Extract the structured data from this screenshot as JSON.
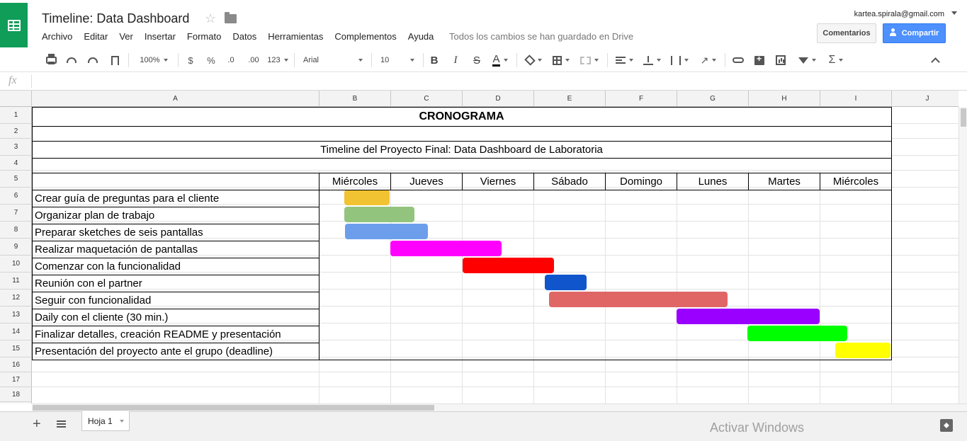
{
  "app": {
    "title": "Timeline: Data Dashboard",
    "account": "kartea.spirala@gmail.com",
    "save_status": "Todos los cambios se han guardado en Drive"
  },
  "menu": [
    "Archivo",
    "Editar",
    "Ver",
    "Insertar",
    "Formato",
    "Datos",
    "Herramientas",
    "Complementos",
    "Ayuda"
  ],
  "buttons": {
    "comments": "Comentarios",
    "share": "Compartir"
  },
  "toolbar": {
    "zoom": "100%",
    "currency": "$",
    "percent": "%",
    "dec_decrease": ".0",
    "dec_increase": ".00",
    "more_formats": "123",
    "font": "Arial",
    "font_size": "10",
    "bold": "B",
    "italic": "I",
    "strike": "S",
    "text_color": "A",
    "text_color_value": "#000000",
    "rotate": "↗",
    "sigma": "Σ"
  },
  "formula_bar": {
    "icon": "fx",
    "content": ""
  },
  "columns": [
    "A",
    "B",
    "C",
    "D",
    "E",
    "F",
    "G",
    "H",
    "I",
    "J"
  ],
  "rows": [
    "1",
    "2",
    "3",
    "4",
    "5",
    "6",
    "7",
    "8",
    "9",
    "10",
    "11",
    "12",
    "13",
    "14",
    "15",
    "16",
    "17",
    "18"
  ],
  "sheet": {
    "heading": "CRONOGRAMA",
    "subtitle": "Timeline del Proyecto Final: Data Dashboard de Laboratoria",
    "days": [
      "Miércoles",
      "Jueves",
      "Viernes",
      "Sábado",
      "Domingo",
      "Lunes",
      "Martes",
      "Miércoles"
    ],
    "tasks": [
      {
        "label": "Crear guía de preguntas para el cliente",
        "color": "#f1c232"
      },
      {
        "label": "Organizar plan de trabajo",
        "color": "#93c47d"
      },
      {
        "label": "Preparar sketches de seis pantallas",
        "color": "#6d9eeb"
      },
      {
        "label": "Realizar maquetación de pantallas",
        "color": "#ff00ff"
      },
      {
        "label": "Comenzar con la funcionalidad",
        "color": "#ff0000"
      },
      {
        "label": "Reunión con el partner",
        "color": "#1155cc"
      },
      {
        "label": "Seguir con funcionalidad",
        "color": "#e06666"
      },
      {
        "label": "Daily con el cliente (30 min.)",
        "color": "#9900ff"
      },
      {
        "label": "Finalizar detalles, creación README y presentación",
        "color": "#00ff00"
      },
      {
        "label": "Presentación del proyecto ante el grupo (deadline)",
        "color": "#ffff00"
      }
    ]
  },
  "tabs": {
    "sheet1": "Hoja 1",
    "add": "+"
  },
  "watermark": "Activar Windows",
  "colors": {
    "logo": "#0f9d58",
    "share_button": "#4d90fe"
  }
}
